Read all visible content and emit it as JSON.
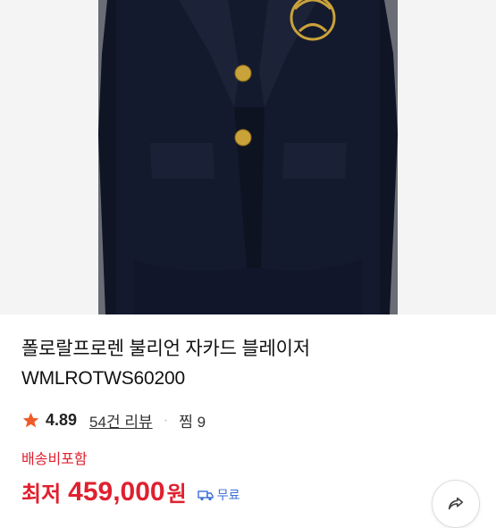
{
  "product": {
    "title": "폴로랄프로렌 불리언 자카드 블레이저 WMLROTWS60200",
    "rating": "4.89",
    "reviews_label": "54건 리뷰",
    "separator": "·",
    "wish_label": "찜 9",
    "shipping_note": "배송비포함",
    "price_label": "최저",
    "price_value": "459,000",
    "price_unit": "원",
    "shipping_badge": "무료"
  },
  "icons": {
    "rating": "star-icon",
    "shipping": "truck-icon",
    "share": "share-icon"
  },
  "colors": {
    "accent": "#e0202f",
    "star": "#f05a28",
    "jacket": "#141a2e",
    "embroidery": "#c9a23a",
    "badge": "#3a6fd8"
  }
}
